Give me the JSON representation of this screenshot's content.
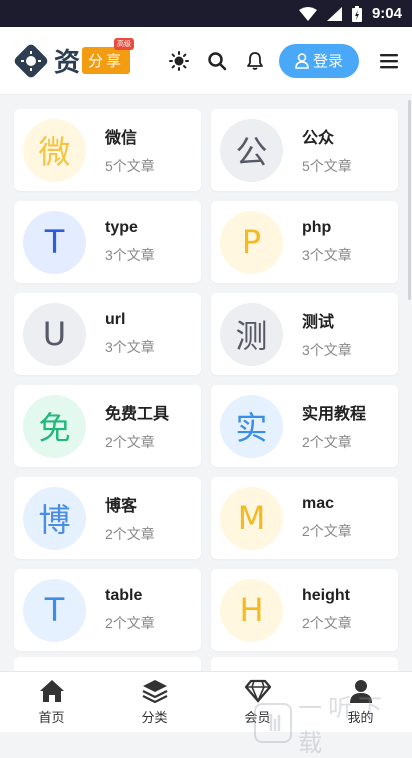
{
  "status_bar": {
    "time": "9:04"
  },
  "header": {
    "logo_main": "资",
    "logo_tag": "分享",
    "logo_mini": "高级",
    "login_label": "登录"
  },
  "categories": [
    {
      "avatar": "微",
      "title": "微信",
      "count": "5个文章",
      "bg": "#fff7e0",
      "fg": "#f5c542"
    },
    {
      "avatar": "公",
      "title": "公众",
      "count": "5个文章",
      "bg": "#eceef2",
      "fg": "#555a66"
    },
    {
      "avatar": "T",
      "title": "type",
      "count": "3个文章",
      "bg": "#e3edff",
      "fg": "#2b5fd9"
    },
    {
      "avatar": "P",
      "title": "php",
      "count": "3个文章",
      "bg": "#fff7e0",
      "fg": "#f5b921"
    },
    {
      "avatar": "U",
      "title": "url",
      "count": "3个文章",
      "bg": "#eceef2",
      "fg": "#555a66"
    },
    {
      "avatar": "测",
      "title": "测试",
      "count": "3个文章",
      "bg": "#eceef2",
      "fg": "#555a66"
    },
    {
      "avatar": "免",
      "title": "免费工具",
      "count": "2个文章",
      "bg": "#e3f8ef",
      "fg": "#21b87a"
    },
    {
      "avatar": "实",
      "title": "实用教程",
      "count": "2个文章",
      "bg": "#e6f1ff",
      "fg": "#3a8ee6"
    },
    {
      "avatar": "博",
      "title": "博客",
      "count": "2个文章",
      "bg": "#e6f1ff",
      "fg": "#4a8ee0"
    },
    {
      "avatar": "M",
      "title": "mac",
      "count": "2个文章",
      "bg": "#fff7e0",
      "fg": "#f5b921"
    },
    {
      "avatar": "T",
      "title": "table",
      "count": "2个文章",
      "bg": "#e6f1ff",
      "fg": "#3a8ee6"
    },
    {
      "avatar": "H",
      "title": "height",
      "count": "2个文章",
      "bg": "#fff7e0",
      "fg": "#f5b921"
    }
  ],
  "bottom_nav": [
    {
      "label": "首页",
      "icon": "home-icon"
    },
    {
      "label": "分类",
      "icon": "layers-icon"
    },
    {
      "label": "会员",
      "icon": "diamond-icon"
    },
    {
      "label": "我的",
      "icon": "user-icon"
    }
  ],
  "watermark": {
    "text": "一听下载"
  }
}
